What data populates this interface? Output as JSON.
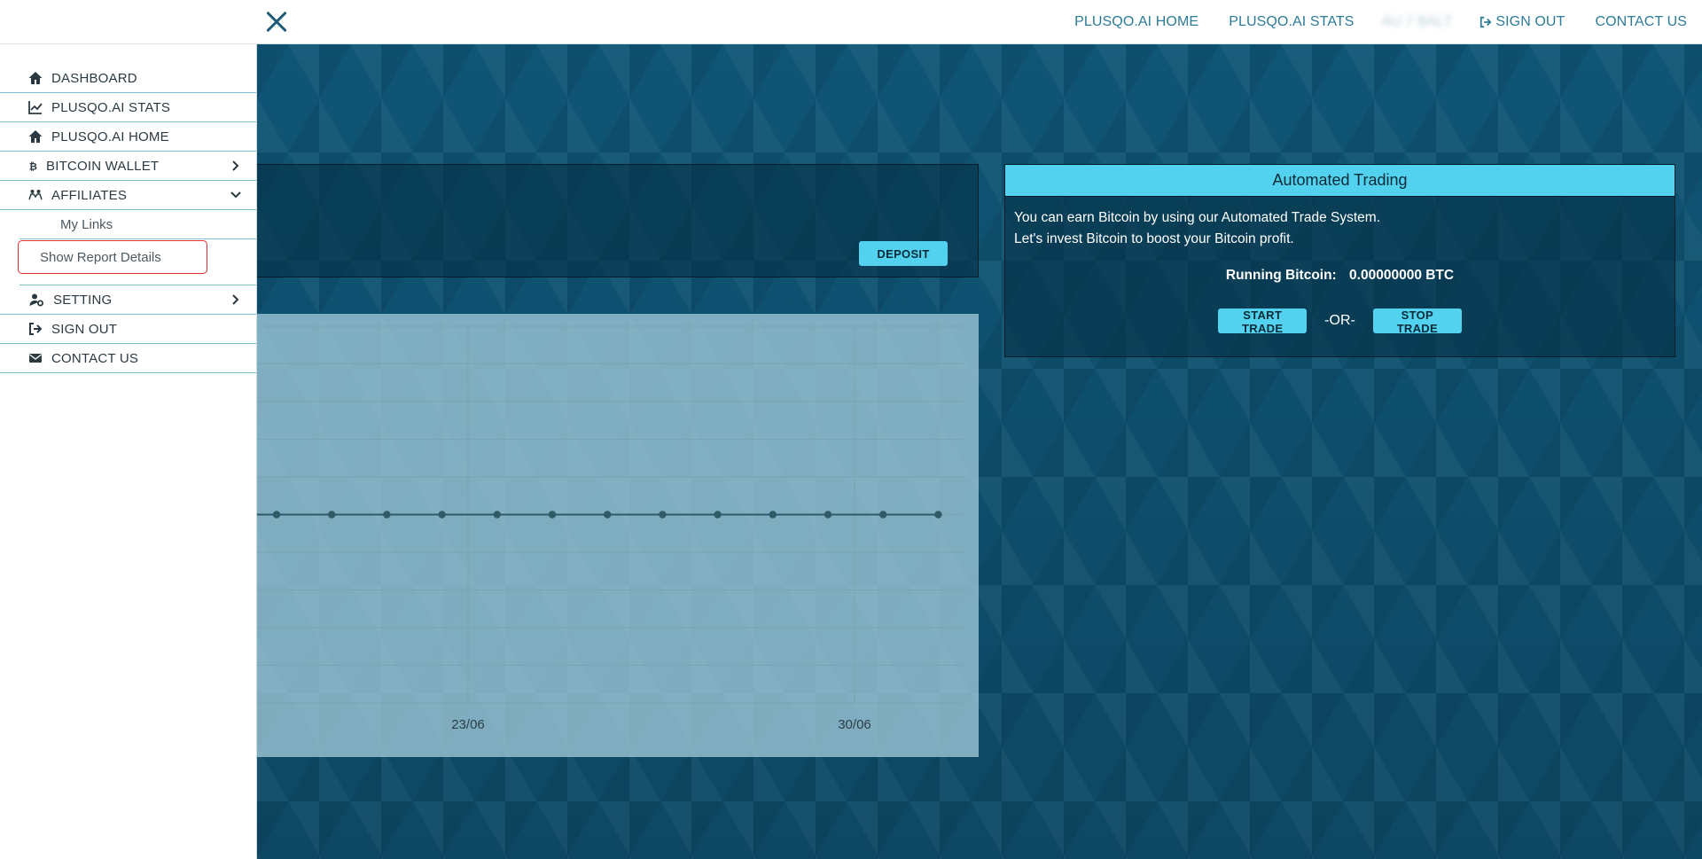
{
  "topbar": {
    "nav": [
      {
        "label": "PLUSQO.AI HOME"
      },
      {
        "label": "PLUSQO.AI STATS"
      },
      {
        "label": "AU 7 BALT"
      },
      {
        "label": "SIGN OUT",
        "icon": "sign-out-icon"
      },
      {
        "label": "CONTACT US"
      }
    ]
  },
  "sidebar": {
    "items": [
      {
        "label": "DASHBOARD",
        "icon": "home-icon"
      },
      {
        "label": "PLUSQO.AI STATS",
        "icon": "line-chart-icon"
      },
      {
        "label": "PLUSQO.AI HOME",
        "icon": "home-icon"
      },
      {
        "label": "BITCOIN WALLET",
        "icon": "bitcoin-icon",
        "chevron": "chevron-right-icon"
      },
      {
        "label": "AFFILIATES",
        "icon": "users-icon",
        "chevron": "chevron-down-icon"
      },
      {
        "label": "SETTING",
        "icon": "user-cog-icon",
        "chevron": "chevron-right-icon"
      },
      {
        "label": "SIGN OUT",
        "icon": "sign-out-icon"
      },
      {
        "label": "CONTACT US",
        "icon": "envelope-icon"
      }
    ],
    "affiliates_sub": [
      {
        "label": "My Links"
      },
      {
        "label": "Show Report Details"
      }
    ]
  },
  "account": {
    "deposit_label": "DEPOSIT"
  },
  "chart_data": {
    "type": "line",
    "x_tick_labels": [
      "23/06",
      "30/06"
    ],
    "series": [
      {
        "values": [
          0,
          0,
          0,
          0,
          0,
          0,
          0,
          0,
          0,
          0,
          0,
          0,
          0
        ]
      }
    ],
    "grid": true,
    "colors": {
      "line": "#2f5a66",
      "grid": "#7aa3b3"
    }
  },
  "trading": {
    "title": "Automated Trading",
    "line1": "You can earn Bitcoin by using our Automated Trade System.",
    "line2": "Let's invest Bitcoin to boost your Bitcoin profit.",
    "running_label": "Running Bitcoin:",
    "running_value": "0.00000000 BTC",
    "start_label": "START TRADE",
    "or_label": "-OR-",
    "stop_label": "STOP TRADE"
  },
  "colors": {
    "accent": "#52d2ee",
    "topnav_text": "#2c7b99",
    "background": "#0e4d6b"
  }
}
